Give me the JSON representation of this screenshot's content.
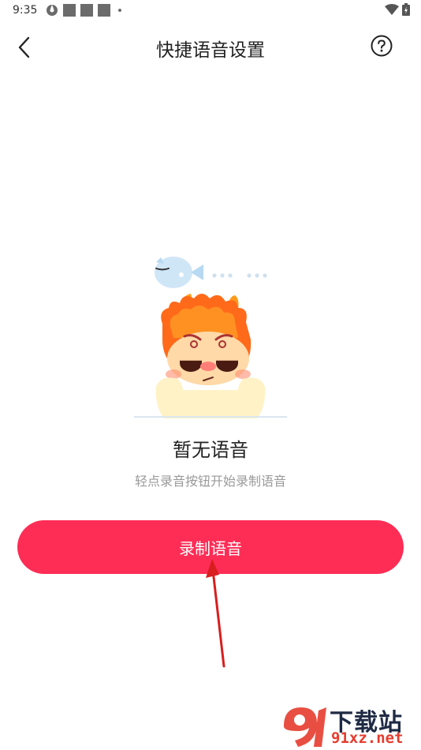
{
  "status_bar": {
    "time": "9:35"
  },
  "header": {
    "title": "快捷语音设置",
    "back_icon": "chevron-left-icon",
    "help_icon": "question-circle-icon"
  },
  "empty_state": {
    "title": "暂无语音",
    "hint": "轻点录音按钮开始录制语音"
  },
  "record_button": {
    "label": "录制语音"
  },
  "colors": {
    "accent": "#fe2d55",
    "arrow": "#d81e1e"
  },
  "watermark": {
    "title": "下载站",
    "url": "91xz.net"
  }
}
